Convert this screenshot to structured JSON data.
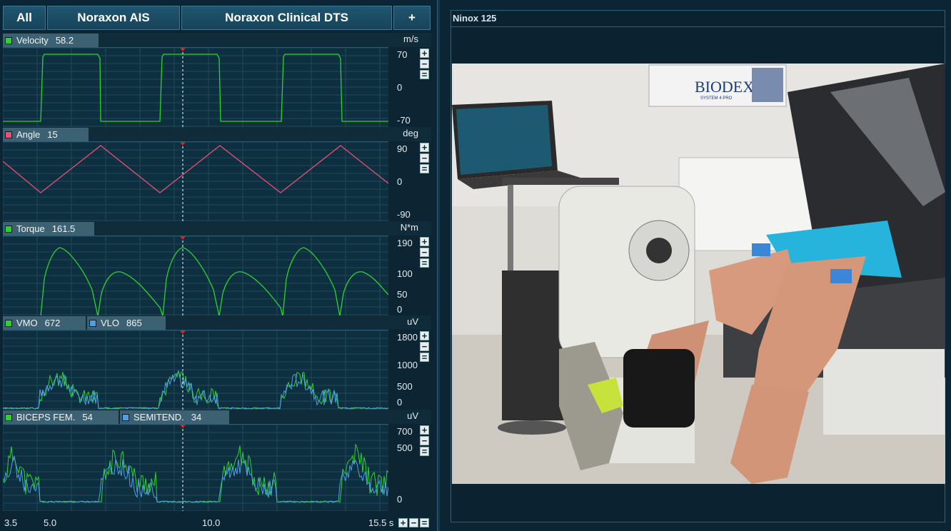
{
  "tabs": {
    "all": "All",
    "ais": "Noraxon AIS",
    "dts": "Noraxon Clinical DTS",
    "add": "+"
  },
  "channels": {
    "velocity": {
      "name": "Velocity",
      "value": "58.2",
      "unit": "m/s",
      "ticks": [
        "70",
        "0",
        "-70"
      ],
      "color": "#2fd12f"
    },
    "angle": {
      "name": "Angle",
      "value": "15",
      "unit": "deg",
      "ticks": [
        "90",
        "0",
        "-90"
      ],
      "color": "#e84f78"
    },
    "torque": {
      "name": "Torque",
      "value": "161.5",
      "unit": "N*m",
      "ticks": [
        "190",
        "100",
        "50",
        "0"
      ],
      "color": "#2fd12f"
    },
    "emg1": {
      "unit": "uV",
      "ticks": [
        "1800",
        "1000",
        "500",
        "0"
      ],
      "a": {
        "name": "VMO",
        "value": "672",
        "color": "#2fd12f"
      },
      "b": {
        "name": "VLO",
        "value": "865",
        "color": "#4f9fe8"
      }
    },
    "emg2": {
      "unit": "uV",
      "ticks": [
        "700",
        "500",
        "0"
      ],
      "a": {
        "name": "BICEPS FEM.",
        "value": "54",
        "color": "#2fd12f"
      },
      "b": {
        "name": "SEMITEND.",
        "value": "34",
        "color": "#4f9fe8"
      }
    }
  },
  "zoom": {
    "plus": "+",
    "minus": "−",
    "fit": "="
  },
  "time_axis": {
    "ticks": [
      "3.5",
      "5.0",
      "10.0",
      "15.5 s"
    ]
  },
  "video": {
    "title": "Ninox 125"
  },
  "poster": {
    "brand": "BIODEX",
    "sub": "SYSTEM 4 PRO"
  }
}
